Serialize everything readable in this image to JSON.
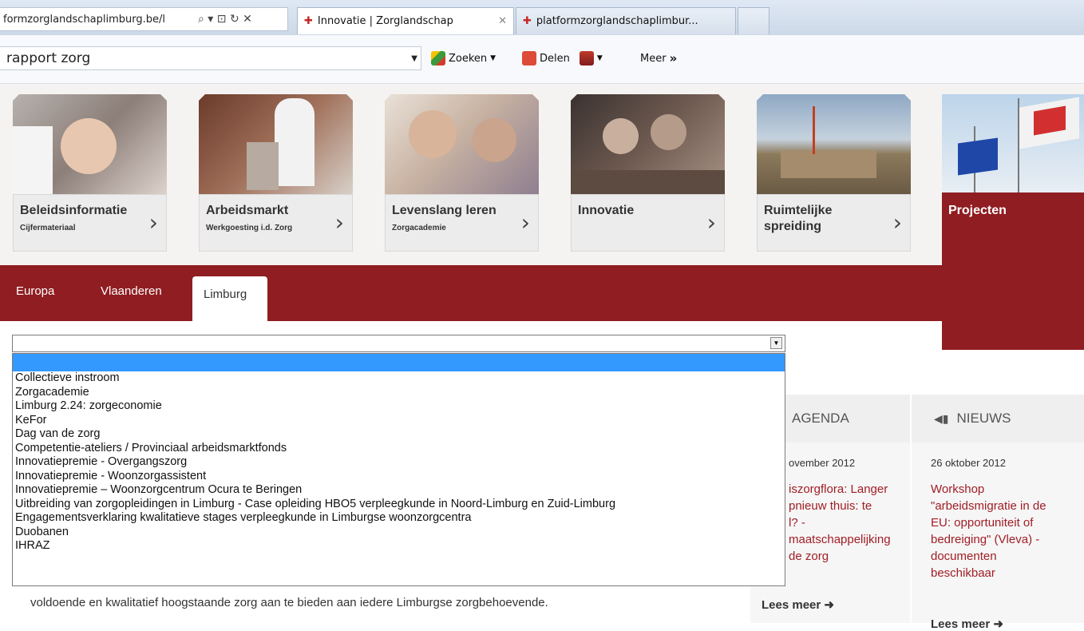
{
  "browser": {
    "address_text": "formzorglandschaplimburg.be/l",
    "address_controls": "⌕ ▾ ⊡ ↻ ✕",
    "tabs": [
      {
        "label": "Innovatie | Zorglandschap",
        "close": "✕"
      },
      {
        "label": "platformzorglandschaplimbur..."
      }
    ]
  },
  "toolbar": {
    "search_value": "rapport zorg",
    "search_button": "Zoeken",
    "share_button": "Delen",
    "more_button": "Meer",
    "more_glyph": "»"
  },
  "site": {
    "cards": [
      {
        "title": "Beleidsinformatie",
        "sub": "Cijfermateriaal"
      },
      {
        "title": "Arbeidsmarkt",
        "sub": "Werkgoesting i.d. Zorg"
      },
      {
        "title": "Levenslang leren",
        "sub": "Zorgacademie"
      },
      {
        "title": "Innovatie",
        "sub": ""
      },
      {
        "title": "Ruimtelijke spreiding",
        "sub": ""
      }
    ],
    "projects_card": {
      "title": "Projecten"
    },
    "sub_tabs": [
      "Europa",
      "Vlaanderen",
      "Limburg"
    ]
  },
  "dropdown": {
    "selected_value": "",
    "options": [
      "",
      "Collectieve instroom",
      "Zorgacademie",
      "Limburg 2.24: zorgeconomie",
      "KeFor",
      "Dag van de zorg",
      "Competentie-ateliers / Provinciaal arbeidsmarktfonds",
      "Innovatiepremie - Overgangszorg",
      "Innovatiepremie - Woonzorgassistent",
      "Innovatiepremie – Woonzorgcentrum Ocura te Beringen",
      "Uitbreiding van zorgopleidingen in Limburg - Case opleiding HBO5 verpleegkunde in Noord-Limburg en Zuid-Limburg",
      "Engagementsverklaring kwalitatieve stages verpleegkunde in Limburgse woonzorgcentra",
      "Duobanen",
      "IHRAZ"
    ]
  },
  "content": {
    "body_line": "voldoende en kwalitatief hoogstaande zorg aan te bieden aan iedere Limburgse zorgbehoevende."
  },
  "agenda": {
    "heading": "AGENDA",
    "date": "ovember 2012",
    "lines": [
      "iszorgflora: Langer",
      "pnieuw thuis: te",
      "l? -",
      "maatschappelijking",
      "de zorg"
    ],
    "more": "Lees meer"
  },
  "news": {
    "heading": "NIEUWS",
    "date": "26 oktober 2012",
    "lines": [
      "Workshop",
      "\"arbeidsmigratie in de",
      "EU: opportuniteit of",
      "bedreiging\" (Vleva) -",
      "documenten",
      "beschikbaar"
    ],
    "more": "Lees meer"
  },
  "colors": {
    "brand_red": "#8f1d21",
    "link_red": "#a01e25",
    "selection_blue": "#3399ff"
  }
}
